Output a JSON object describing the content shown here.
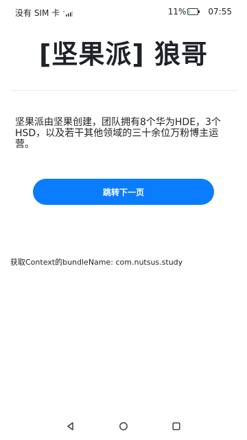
{
  "status_bar": {
    "carrier": "没有 SIM 卡",
    "battery_percent": "11%",
    "battery_level": 0.11,
    "time": "07:55"
  },
  "header": {
    "title": "[坚果派] 狼哥"
  },
  "main": {
    "description": "坚果派由坚果创建，团队拥有8个华为HDE，3个HSD，以及若干其他领域的三十余位万粉博主运营。",
    "next_button_label": "跳转下一页",
    "bundle_info": "获取Context的bundleName: com.nutsus.study"
  },
  "nav_bar": {
    "back_icon": "back-triangle-icon",
    "home_icon": "home-circle-icon",
    "recent_icon": "recent-square-icon"
  },
  "colors": {
    "accent": "#0a7cff",
    "battery": "#2ecc40"
  }
}
